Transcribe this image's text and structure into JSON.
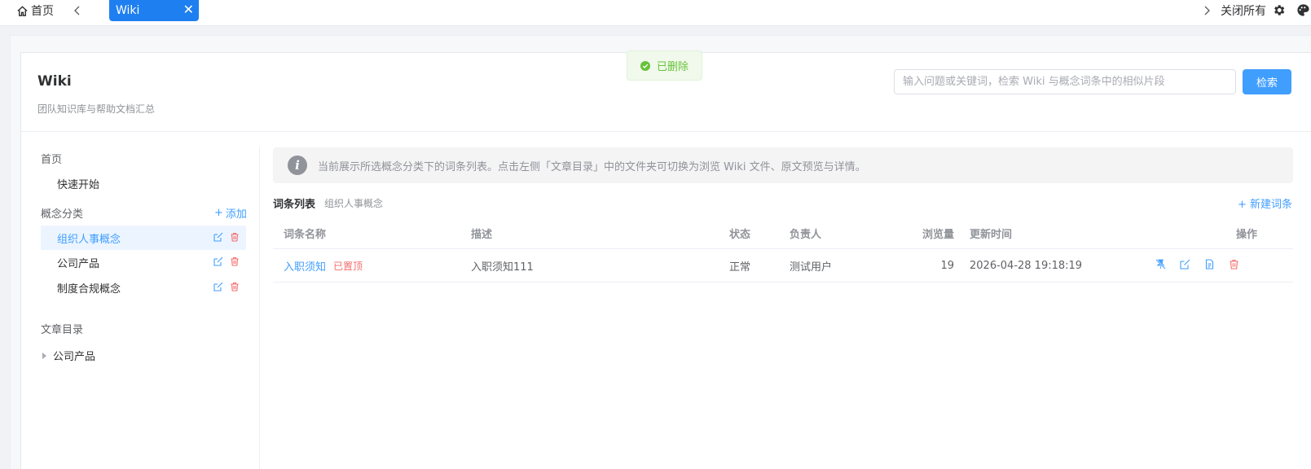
{
  "topbar": {
    "home_label": "首页",
    "active_tab_label": "Wiki",
    "tab_close_glyph": "✕",
    "close_all_label": "关闭所有",
    "icons": [
      "home-icon",
      "chevron-left-icon",
      "chevron-right-icon",
      "gear-icon",
      "palette-icon"
    ]
  },
  "toast": {
    "text": "已删除",
    "color": "#67c23a"
  },
  "header": {
    "title": "Wiki",
    "subtitle": "团队知识库与帮助文档汇总",
    "search_placeholder": "输入问题或关键词，检索 Wiki 与概念词条中的相似片段",
    "search_value": "",
    "search_button": "检索"
  },
  "sidebar": {
    "home_section": "首页",
    "quick_start": "快速开始",
    "concept_section": "概念分类",
    "add_label": "添加",
    "categories": [
      {
        "label": "组织人事概念",
        "active": true
      },
      {
        "label": "公司产品",
        "active": false
      },
      {
        "label": "制度合规概念",
        "active": false
      }
    ],
    "article_section": "文章目录",
    "tree": [
      {
        "label": "公司产品"
      }
    ]
  },
  "main": {
    "alert": "当前展示所选概念分类下的词条列表。点击左侧「文章目录」中的文件夹可切换为浏览 Wiki 文件、原文预览与详情。",
    "list_title": "词条列表",
    "list_subtitle": "组织人事概念",
    "new_entry": "+ 新建词条",
    "columns": {
      "name": "词条名称",
      "desc": "描述",
      "status": "状态",
      "owner": "负责人",
      "views": "浏览量",
      "updated": "更新时间",
      "ops": "操作"
    },
    "rows": [
      {
        "name": "入职须知",
        "pin_tag": "已置顶",
        "desc": "入职须知111",
        "status": "正常",
        "owner": "测试用户",
        "views": "19",
        "updated": "2026-04-28 19:18:19"
      }
    ]
  },
  "colors": {
    "primary": "#409eff",
    "tab_active": "#1e7ff0",
    "danger": "#f56c6c",
    "success": "#67c23a"
  }
}
